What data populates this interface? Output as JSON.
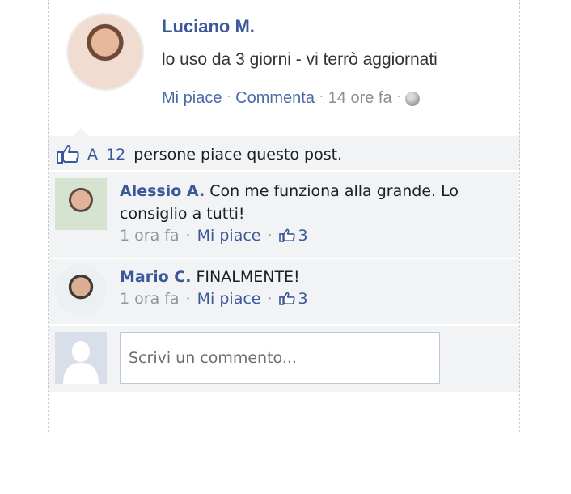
{
  "post": {
    "author": "Luciano M.",
    "text": "lo uso da 3 giorni - vi terrò aggiornati",
    "actions": {
      "like": "Mi piace",
      "comment": "Commenta",
      "time": "14 ore fa"
    }
  },
  "likes": {
    "prefix": "A",
    "count": "12",
    "suffix": "persone piace questo post."
  },
  "comments": [
    {
      "author": "Alessio A.",
      "text": "Con me funziona alla grande. Lo consiglio a tutti!",
      "time": "1 ora fa",
      "like": "Mi piace",
      "likes": "3"
    },
    {
      "author": "Mario C.",
      "text": "FINALMENTE!",
      "time": "1 ora fa",
      "like": "Mi piace",
      "likes": "3"
    }
  ],
  "composer": {
    "placeholder": "Scrivi un commento..."
  },
  "icons": {
    "like": "thumbs-up-icon",
    "privacy": "globe-icon"
  },
  "colors": {
    "brand": "#3b5998",
    "background_panel": "#f2f3f5"
  }
}
